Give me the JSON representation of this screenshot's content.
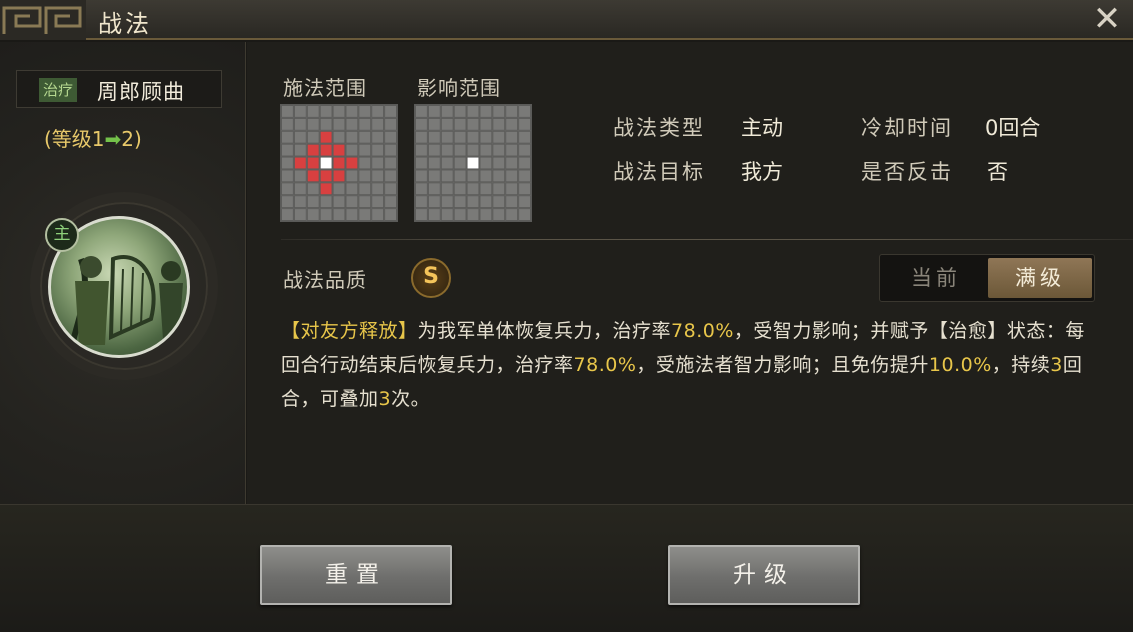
{
  "window": {
    "title": "战法",
    "close_icon": "close-icon"
  },
  "skill": {
    "type_tag": "治疗",
    "name": "周郎顾曲",
    "level_prefix": "(等级1",
    "level_arrow": "➡",
    "level_suffix": "2)",
    "main_badge": "主"
  },
  "ranges": {
    "cast_label": "施法范围",
    "effect_label": "影响范围",
    "cast_cells_red": [
      [
        3,
        2
      ],
      [
        2,
        3
      ],
      [
        3,
        3
      ],
      [
        4,
        3
      ],
      [
        1,
        4
      ],
      [
        2,
        4
      ],
      [
        4,
        4
      ],
      [
        5,
        4
      ],
      [
        2,
        5
      ],
      [
        3,
        5
      ],
      [
        4,
        5
      ],
      [
        3,
        6
      ]
    ],
    "cast_center": [
      3,
      4
    ],
    "effect_center": [
      4,
      4
    ]
  },
  "info": {
    "type_label": "战法类型",
    "type_value": "主动",
    "cooldown_label": "冷却时间",
    "cooldown_value": "0回合",
    "target_label": "战法目标",
    "target_value": "我方",
    "counter_label": "是否反击",
    "counter_value": "否"
  },
  "quality": {
    "label": "战法品质",
    "grade": "S"
  },
  "toggle": {
    "current": "当前",
    "max": "满级"
  },
  "description": {
    "p1": "【对友方释放】",
    "p2": "为我军单体恢复兵力，治疗率",
    "v1": "78.0%",
    "p3": "，受智力影响；并赋予【治愈】状态：每回合行动结束后恢复兵力，治疗率",
    "v2": "78.0%",
    "p4": "，受施法者智力影响；且免伤提升",
    "v3": "10.0%",
    "p5": "，持续",
    "v4": "3",
    "p6": "回合，可叠加",
    "v5": "3",
    "p7": "次。"
  },
  "buttons": {
    "reset": "重置",
    "upgrade": "升级"
  },
  "colors": {
    "accent_gold": "#e8c64a",
    "cast_red": "#d84040",
    "level_green": "#74c24a"
  }
}
